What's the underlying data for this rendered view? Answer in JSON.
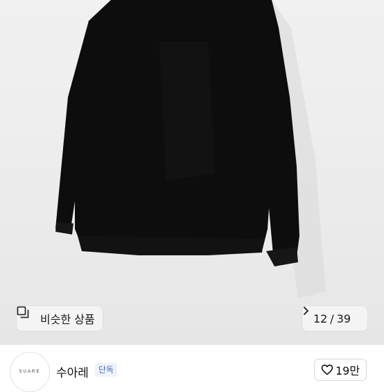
{
  "image": {
    "description_icon": "product-photo"
  },
  "similar": {
    "label": "비슷한 상품",
    "icon": "similar-items-icon"
  },
  "pagination": {
    "current": "12",
    "separator": "/",
    "total": "39",
    "icon": "chevron-right-icon"
  },
  "shop": {
    "logo_text": "SUARE",
    "name": "수아레",
    "badge": "단독"
  },
  "like": {
    "count": "19만",
    "icon": "heart-icon"
  },
  "colors": {
    "image_bg": "#ececec",
    "garment": "#0d0d0d",
    "badge_bg": "#eef3fb",
    "badge_text": "#4a6fb5"
  }
}
